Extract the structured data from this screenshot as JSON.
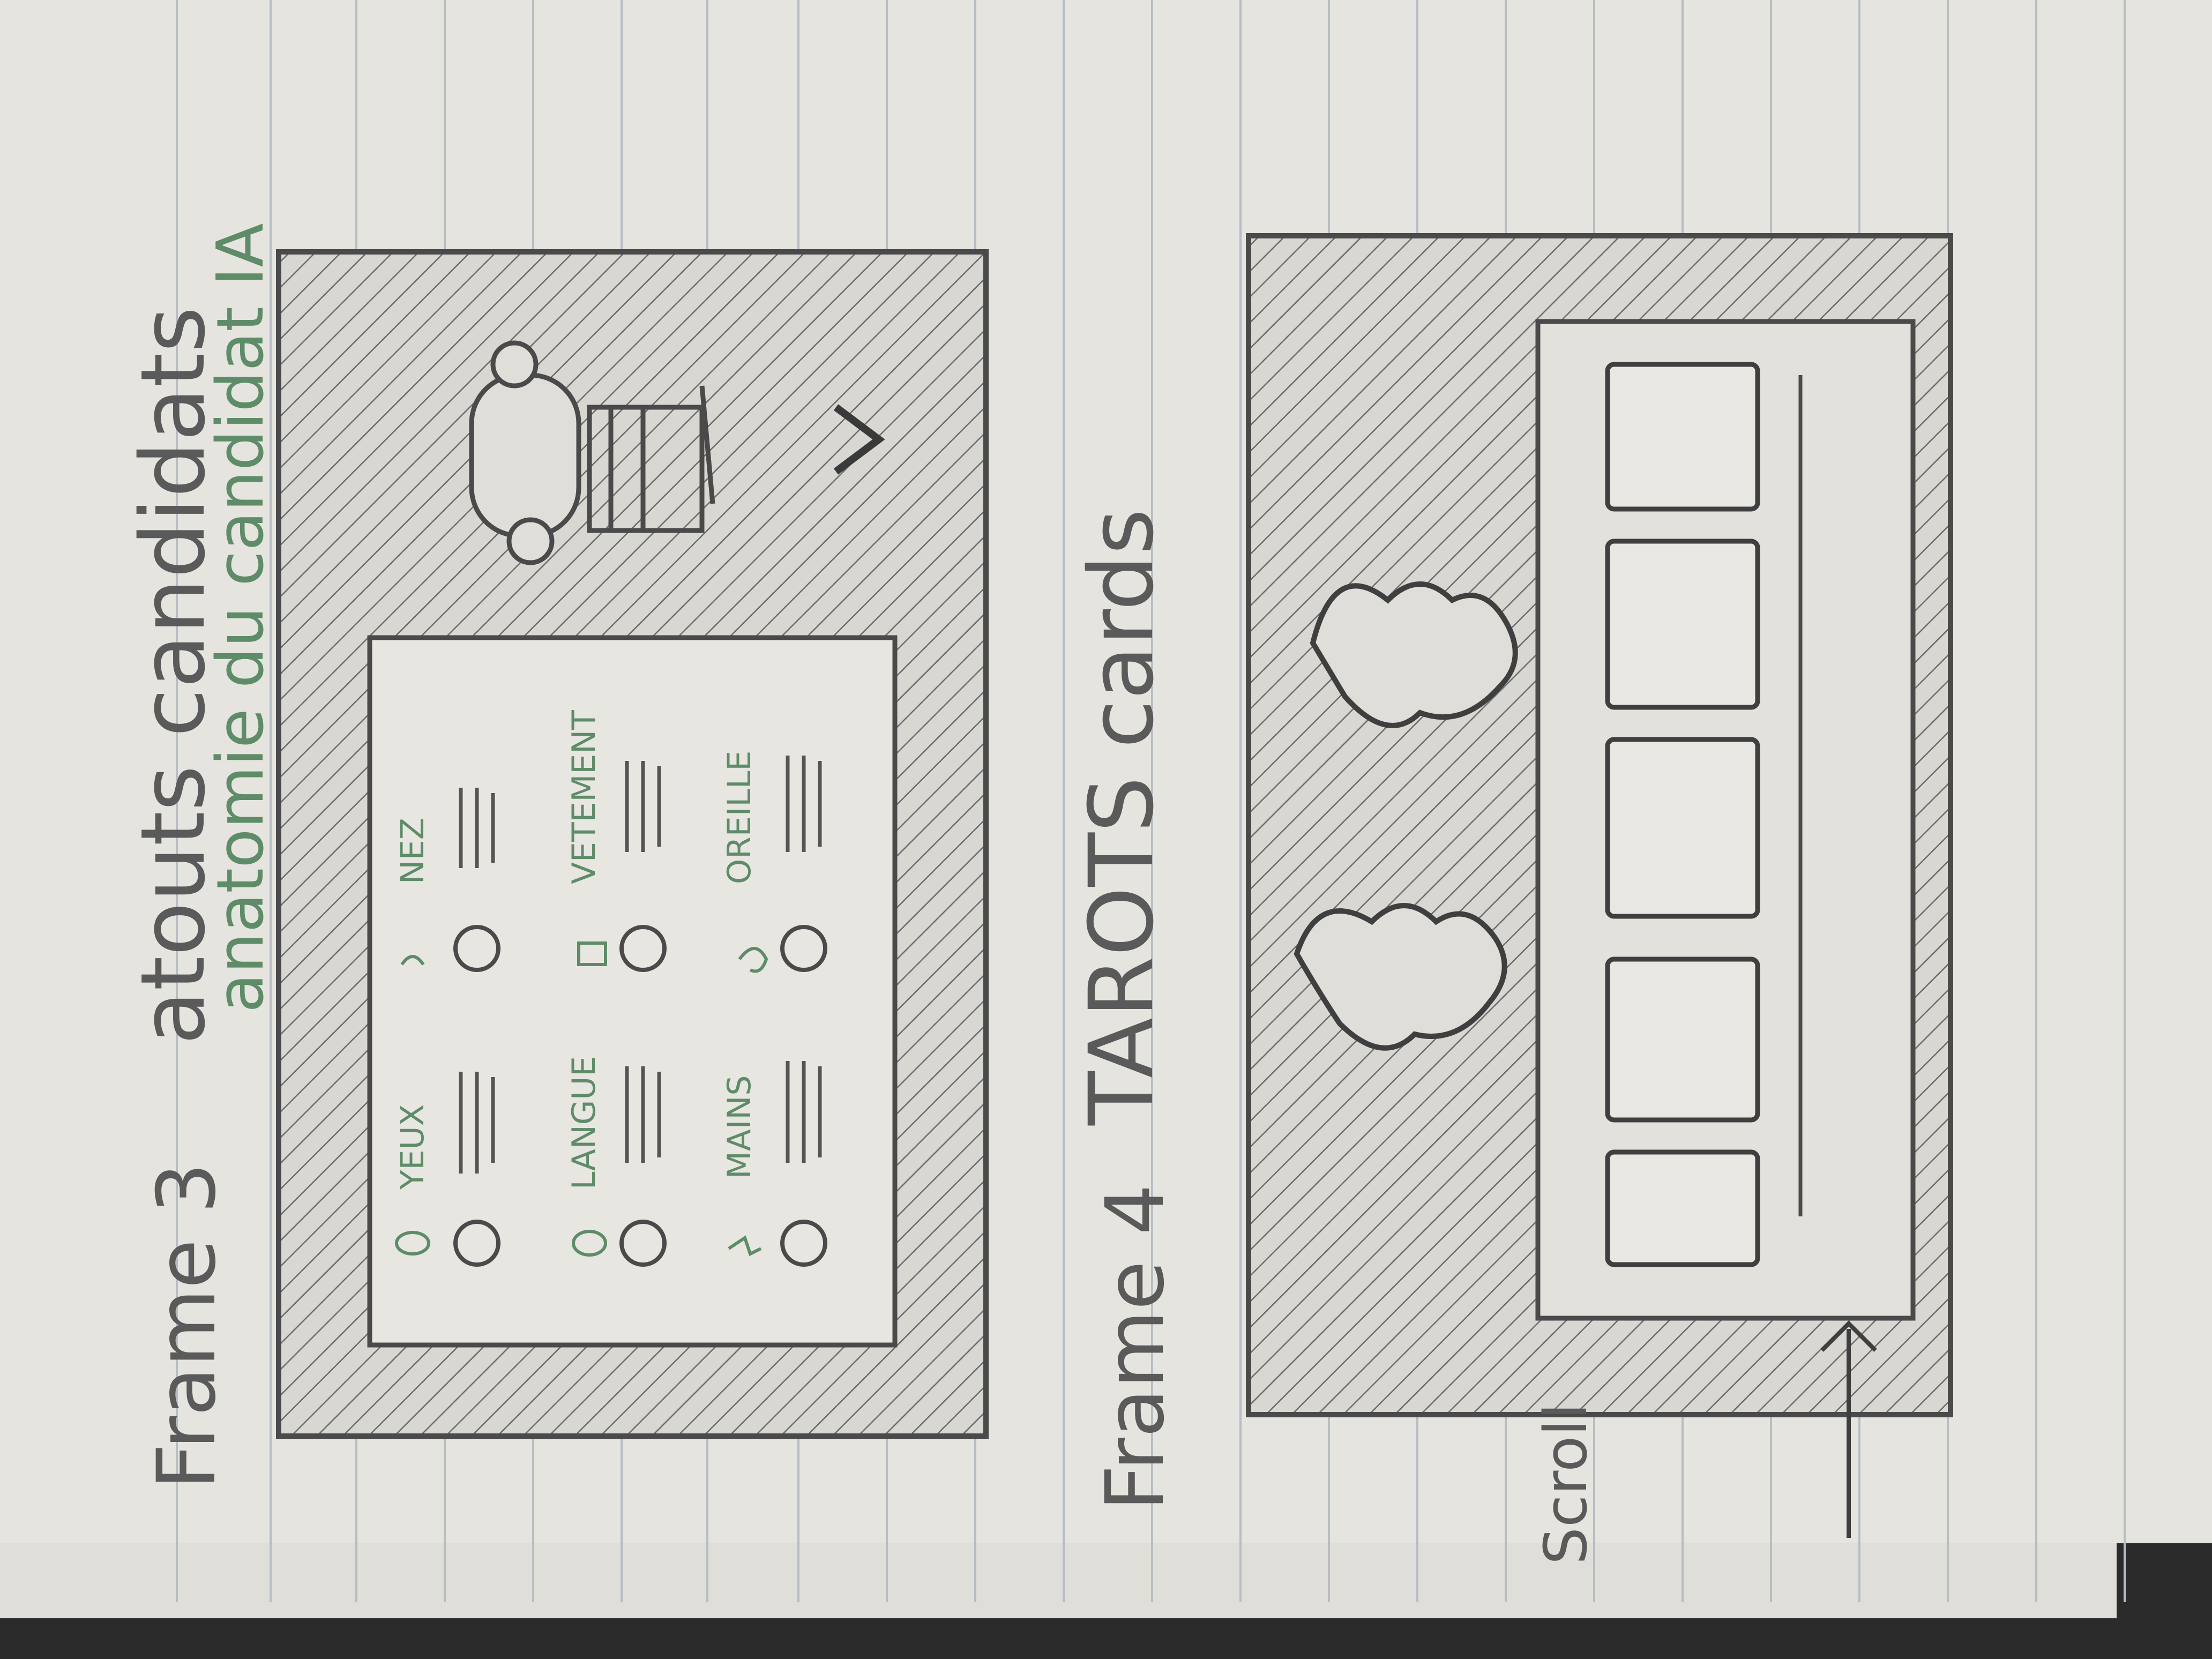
{
  "frame3": {
    "title": "Frame 3",
    "heading": "atouts candidats",
    "subheading": "anatomie du candidat IA",
    "traits": [
      {
        "label": "YEUX",
        "icon": "eye-icon"
      },
      {
        "label": "NEZ",
        "icon": "nose-icon"
      },
      {
        "label": "LANGUE",
        "icon": "mouth-icon"
      },
      {
        "label": "VETEMENT",
        "icon": "shirt-icon"
      },
      {
        "label": "MAINS",
        "icon": "hand-icon"
      },
      {
        "label": "OREILLE",
        "icon": "ear-icon"
      }
    ],
    "next_icon": "chevron-right-icon"
  },
  "frame4": {
    "title": "Frame 4",
    "heading": "TAROTS cards",
    "scroll_label": "Scroll",
    "card_count": 5
  },
  "colors": {
    "paper": "#e6e4df",
    "pencil": "#555555",
    "green_ink": "#5e8c68"
  }
}
